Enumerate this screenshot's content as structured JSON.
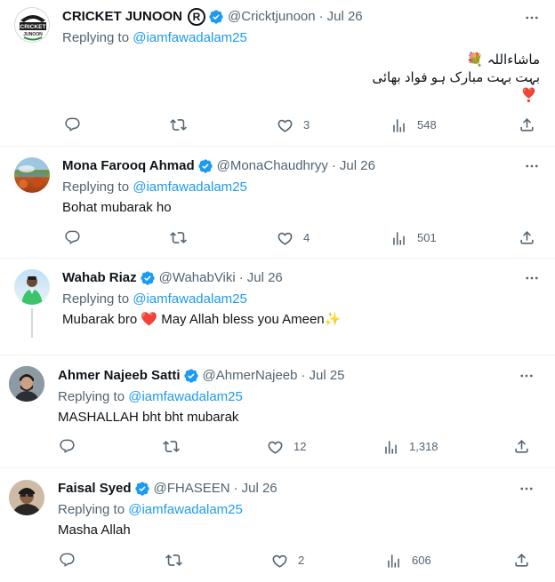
{
  "tweets": [
    {
      "name": "CRICKET JUNOON",
      "reg_mark": "R",
      "handle": "@Cricktjunoon",
      "sep": "·",
      "date": "Jul 26",
      "replying_prefix": "Replying to ",
      "replying_to": "@iamfawadalam25",
      "text_lines": [
        "ماشاءاللہ 💐",
        "بہت بہت مبارک ہو فواد بھائی",
        "❣️"
      ],
      "replies": "",
      "retweets": "",
      "likes": "3",
      "views": "548",
      "avatar_text": "CRICKET JUNOON"
    },
    {
      "name": "Mona Farooq Ahmad",
      "handle": "@MonaChaudhryy",
      "sep": "·",
      "date": "Jul 26",
      "replying_prefix": "Replying to ",
      "replying_to": "@iamfawadalam25",
      "text_lines": [
        "Bohat mubarak ho"
      ],
      "replies": "",
      "retweets": "",
      "likes": "4",
      "views": "501"
    },
    {
      "name": "Wahab Riaz",
      "handle": "@WahabViki",
      "sep": "·",
      "date": "Jul 26",
      "replying_prefix": "Replying to ",
      "replying_to": "@iamfawadalam25",
      "text_lines": [
        "Mubarak bro ❤️ May Allah bless you Ameen✨"
      ]
    },
    {
      "name": "Ahmer Najeeb Satti",
      "handle": "@AhmerNajeeb",
      "sep": "·",
      "date": "Jul 25",
      "replying_prefix": "Replying to ",
      "replying_to": "@iamfawadalam25",
      "text_lines": [
        "MASHALLAH bht bht mubarak"
      ],
      "replies": "",
      "retweets": "",
      "likes": "12",
      "views": "1,318"
    },
    {
      "name": "Faisal Syed",
      "handle": "@FHASEEN",
      "sep": "·",
      "date": "Jul 26",
      "replying_prefix": "Replying to ",
      "replying_to": "@iamfawadalam25",
      "text_lines": [
        "Masha Allah"
      ],
      "replies": "",
      "retweets": "",
      "likes": "2",
      "views": "606"
    }
  ],
  "colors": {
    "text": "#0f1419",
    "secondary": "#536471",
    "link": "#1d9bf0",
    "verified": "#1d9bf0",
    "separator": "#eff3f4"
  },
  "icons": [
    "reply-icon",
    "retweet-icon",
    "like-icon",
    "views-icon",
    "share-icon",
    "more-icon",
    "verified-badge-icon"
  ]
}
